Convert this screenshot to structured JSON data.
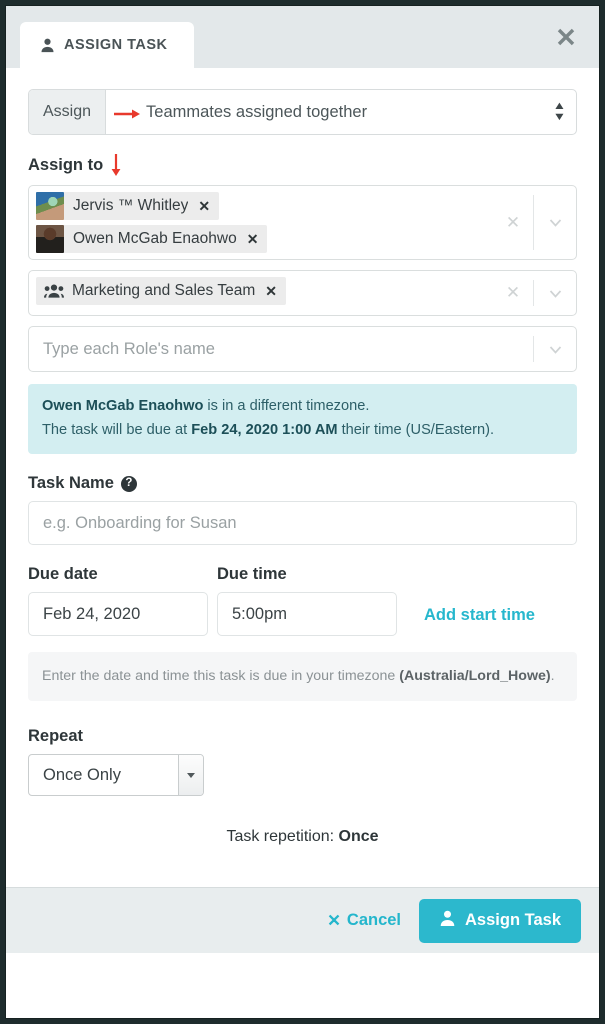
{
  "window": {
    "tab_label": "ASSIGN TASK",
    "tab_icon": "person-icon",
    "close_icon": "close-icon"
  },
  "assign_select": {
    "prefix_label": "Assign",
    "value": "Teammates assigned together",
    "annotation_icon": "red-right-arrow"
  },
  "assign_to": {
    "label": "Assign to",
    "annotation_icon": "red-down-arrow",
    "members_field": {
      "tags": [
        {
          "name": "Jervis ™ Whitley",
          "avatar": "avatar-jervis",
          "remove_icon": "x-icon"
        },
        {
          "name": "Owen McGab Enaohwo",
          "avatar": "avatar-owen",
          "remove_icon": "x-icon"
        }
      ],
      "clear_icon": "x-icon",
      "caret_icon": "chevron-down-icon"
    },
    "teams_field": {
      "tags": [
        {
          "name": "Marketing and Sales Team",
          "icon": "users-group-icon",
          "remove_icon": "x-icon"
        }
      ],
      "clear_icon": "x-icon",
      "caret_icon": "chevron-down-icon"
    },
    "roles_field": {
      "placeholder": "Type each Role's name",
      "caret_icon": "chevron-down-icon"
    }
  },
  "timezone_notice": {
    "person": "Owen McGab Enaohwo",
    "line1_rest": " is in a different timezone.",
    "line2_prefix": "The task will be due at ",
    "due_datetime": "Feb 24, 2020 1:00 AM",
    "line2_suffix": " their time (US/Eastern)."
  },
  "task_name": {
    "label": "Task Name",
    "help_icon": "question-mark-icon",
    "placeholder": "e.g. Onboarding for Susan",
    "value": ""
  },
  "due": {
    "date_label": "Due date",
    "time_label": "Due time",
    "date_value": "Feb 24, 2020",
    "time_value": "5:00pm",
    "add_start_time_label": "Add start time",
    "helper_text": "Enter the date and time this task is due in your timezone",
    "helper_timezone": "(Australia/Lord_Howe)",
    "helper_period": "."
  },
  "repeat": {
    "label": "Repeat",
    "selected": "Once Only",
    "options": [
      "Once Only"
    ],
    "repetition_prefix": "Task repetition: ",
    "repetition_value": "Once"
  },
  "footer": {
    "cancel_label": "Cancel",
    "cancel_icon": "x-icon",
    "submit_label": "Assign Task",
    "submit_icon": "person-icon"
  },
  "colors": {
    "accent_teal": "#2cb8cd",
    "info_bg": "#d3eef1",
    "header_bg": "#e3e8ea",
    "annotation_red": "#e8392c"
  }
}
